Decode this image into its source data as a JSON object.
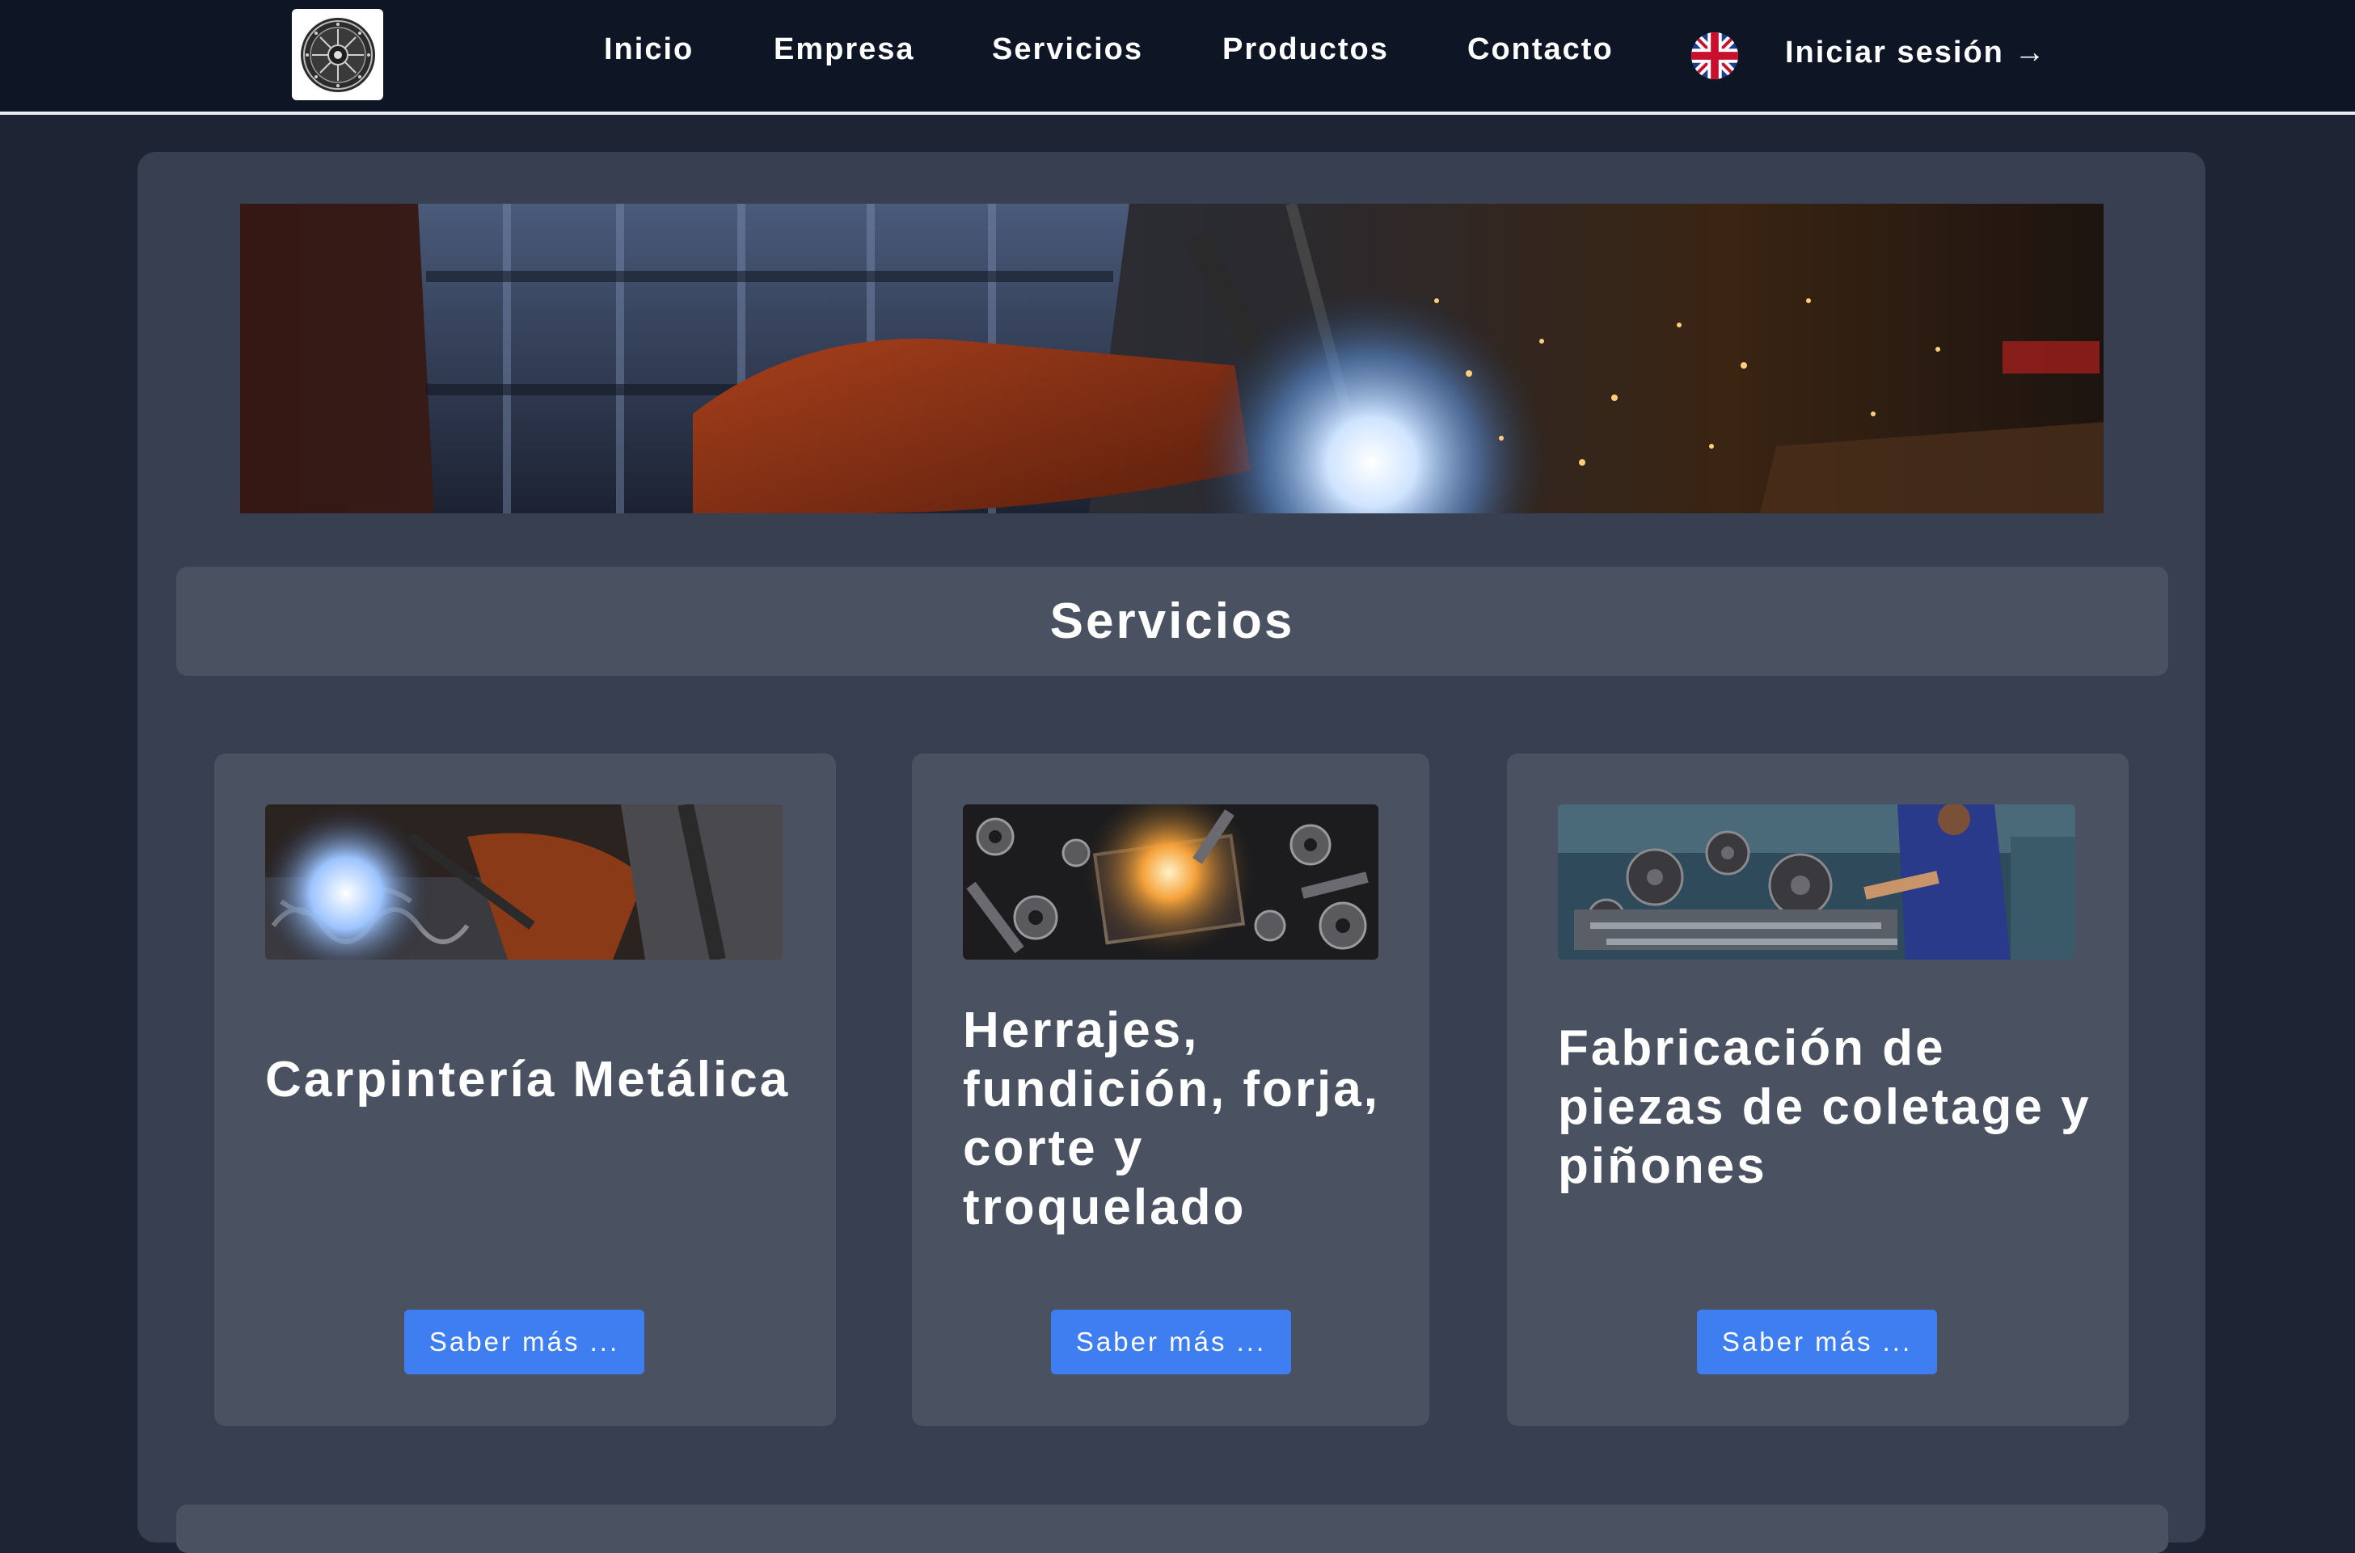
{
  "header": {
    "logo_name": "company-emblem",
    "nav": [
      {
        "label": "Inicio"
      },
      {
        "label": "Empresa"
      },
      {
        "label": "Servicios"
      },
      {
        "label": "Productos"
      },
      {
        "label": "Contacto"
      }
    ],
    "language_icon": "uk-flag-icon",
    "login_label": "Iniciar sesión →"
  },
  "main": {
    "hero_image": "welding-worker-sparks",
    "section_title": "Servicios",
    "cards": [
      {
        "title": "Carpintería Metálica",
        "image": "welding-ornamental-ironwork",
        "button": "Saber más ..."
      },
      {
        "title": "Herrajes, fundición, forja, corte y troquelado",
        "image": "metal-hardware-forging",
        "button": "Saber más ..."
      },
      {
        "title": "Fabricación de piezas de coletage y piñones",
        "image": "machinist-gears-workshop",
        "button": "Saber más ..."
      }
    ]
  },
  "colors": {
    "page_bg": "#1e2434",
    "header_bg": "#0e1626",
    "panel_bg": "#373f51",
    "card_bg": "#4a5262",
    "button_bg": "#3f7ef0"
  }
}
